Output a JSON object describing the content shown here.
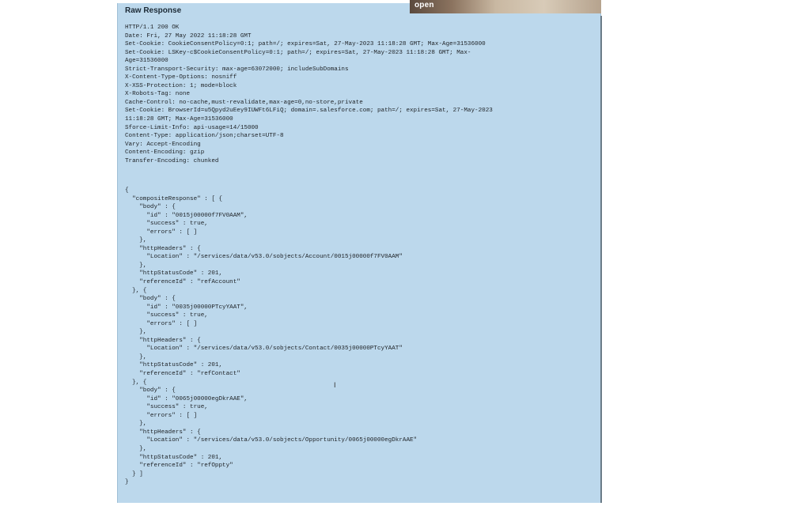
{
  "panel": {
    "title": "Raw Response"
  },
  "video_overlay": {
    "caption": "open"
  },
  "headers_text": "HTTP/1.1 200 OK\nDate: Fri, 27 May 2022 11:18:28 GMT\nSet-Cookie: CookieConsentPolicy=0:1; path=/; expires=Sat, 27-May-2023 11:18:28 GMT; Max-Age=31536000\nSet-Cookie: LSKey-c$CookieConsentPolicy=0:1; path=/; expires=Sat, 27-May-2023 11:18:28 GMT; Max-\nAge=31536000\nStrict-Transport-Security: max-age=63072000; includeSubDomains\nX-Content-Type-Options: nosniff\nX-XSS-Protection: 1; mode=block\nX-Robots-Tag: none\nCache-Control: no-cache,must-revalidate,max-age=0,no-store,private\nSet-Cookie: BrowserId=u5Qpyd2uEey9IUWFt6LFiQ; domain=.salesforce.com; path=/; expires=Sat, 27-May-2023\n11:18:28 GMT; Max-Age=31536000\nSforce-Limit-Info: api-usage=14/15000\nContent-Type: application/json;charset=UTF-8\nVary: Accept-Encoding\nContent-Encoding: gzip\nTransfer-Encoding: chunked",
  "json_text": "{\n  \"compositeResponse\" : [ {\n    \"body\" : {\n      \"id\" : \"0015j00000f7FV0AAM\",\n      \"success\" : true,\n      \"errors\" : [ ]\n    },\n    \"httpHeaders\" : {\n      \"Location\" : \"/services/data/v53.0/sobjects/Account/0015j00000f7FV0AAM\"\n    },\n    \"httpStatusCode\" : 201,\n    \"referenceId\" : \"refAccount\"\n  }, {\n    \"body\" : {\n      \"id\" : \"0035j00000PTcyYAAT\",\n      \"success\" : true,\n      \"errors\" : [ ]\n    },\n    \"httpHeaders\" : {\n      \"Location\" : \"/services/data/v53.0/sobjects/Contact/0035j00000PTcyYAAT\"\n    },\n    \"httpStatusCode\" : 201,\n    \"referenceId\" : \"refContact\"\n  }, {\n    \"body\" : {\n      \"id\" : \"0065j00000egDkrAAE\",\n      \"success\" : true,\n      \"errors\" : [ ]\n    },\n    \"httpHeaders\" : {\n      \"Location\" : \"/services/data/v53.0/sobjects/Opportunity/0065j00000egDkrAAE\"\n    },\n    \"httpStatusCode\" : 201,\n    \"referenceId\" : \"refOppty\"\n  } ]\n}",
  "colors": {
    "panel_background": "#bcd8ec",
    "text": "#1e2226"
  }
}
